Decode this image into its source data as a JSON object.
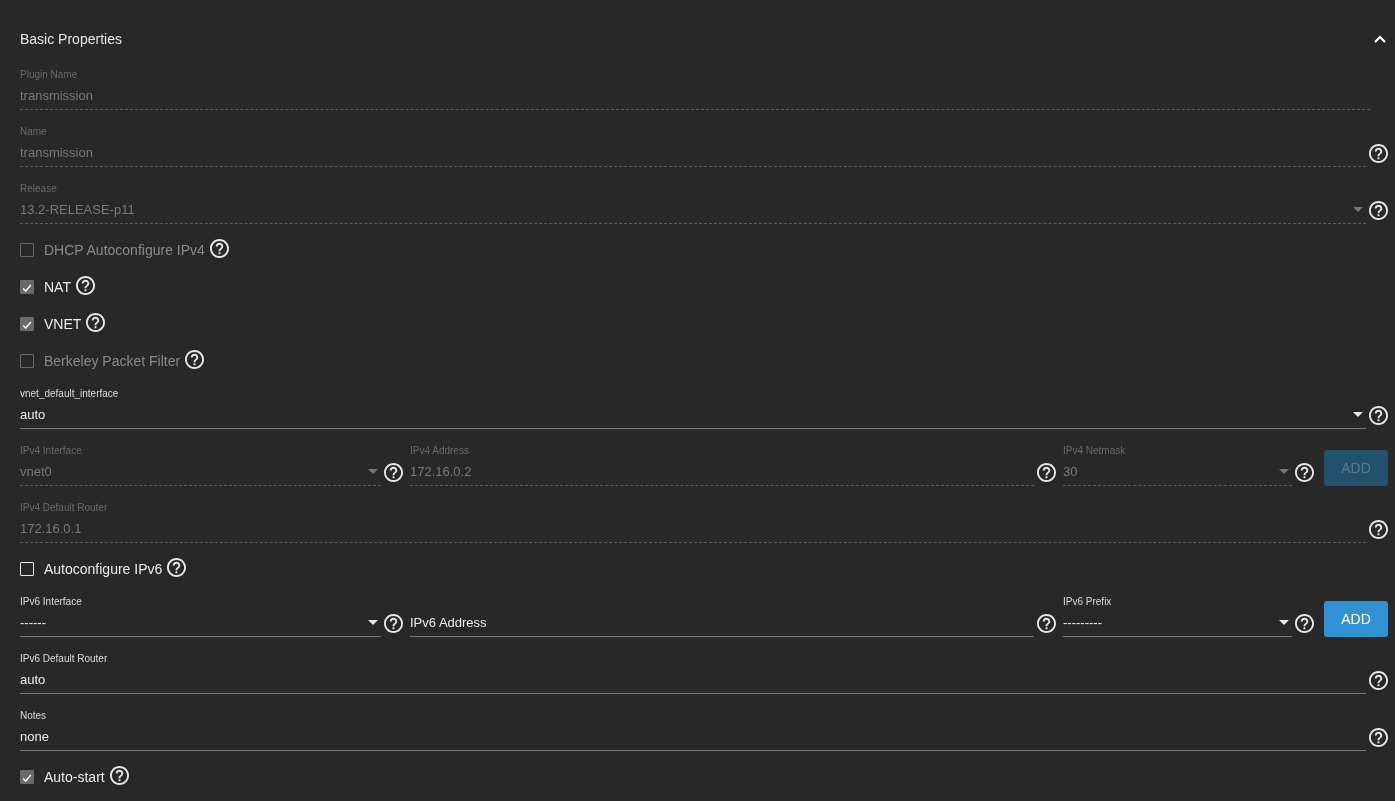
{
  "section": {
    "title": "Basic Properties",
    "expanded": true
  },
  "items": [
    {
      "kind": "text",
      "label": "Plugin Name",
      "value": "transmission",
      "disabled": true,
      "help": false
    },
    {
      "kind": "text",
      "label": "Name",
      "value": "transmission",
      "disabled": true,
      "help": true
    },
    {
      "kind": "select",
      "label": "Release",
      "value": "13.2-RELEASE-p11",
      "disabled": true,
      "help": true
    },
    {
      "kind": "checkbox",
      "label": "DHCP Autoconfigure IPv4",
      "checked": false,
      "disabled": true
    },
    {
      "kind": "checkbox",
      "label": "NAT",
      "checked": true,
      "disabled": false
    },
    {
      "kind": "checkbox",
      "label": "VNET",
      "checked": true,
      "disabled": false
    },
    {
      "kind": "checkbox",
      "label": "Berkeley Packet Filter",
      "checked": false,
      "disabled": true
    },
    {
      "kind": "select",
      "label": "vnet_default_interface",
      "value": "auto",
      "disabled": false,
      "help": true
    },
    {
      "kind": "row",
      "fields": [
        {
          "kind": "select",
          "label": "IPv4 Interface",
          "value": "vnet0",
          "disabled": true,
          "help": true
        },
        {
          "kind": "text",
          "label": "IPv4 Address",
          "value": "172.16.0.2",
          "disabled": true,
          "help": true
        },
        {
          "kind": "select",
          "label": "IPv4 Netmask",
          "value": "30",
          "disabled": true,
          "help": true
        }
      ],
      "button": {
        "label": "ADD",
        "disabled": true
      }
    },
    {
      "kind": "text",
      "label": "IPv4 Default Router",
      "value": "172.16.0.1",
      "disabled": true,
      "help": true
    },
    {
      "kind": "checkbox",
      "label": "Autoconfigure IPv6",
      "checked": false,
      "disabled": false
    },
    {
      "kind": "row",
      "fields": [
        {
          "kind": "select",
          "label": "IPv6 Interface",
          "value": "------",
          "disabled": false,
          "help": true
        },
        {
          "kind": "text",
          "placeholder": "IPv6 Address",
          "disabled": false,
          "help": true
        },
        {
          "kind": "select",
          "label": "IPv6 Prefix",
          "value": "---------",
          "disabled": false,
          "help": true
        }
      ],
      "button": {
        "label": "ADD",
        "disabled": false
      }
    },
    {
      "kind": "text",
      "label": "IPv6 Default Router",
      "value": "auto",
      "disabled": false,
      "help": true
    },
    {
      "kind": "text",
      "label": "Notes",
      "value": "none",
      "disabled": false,
      "help": true
    },
    {
      "kind": "checkbox",
      "label": "Auto-start",
      "checked": true,
      "disabled": false
    }
  ]
}
